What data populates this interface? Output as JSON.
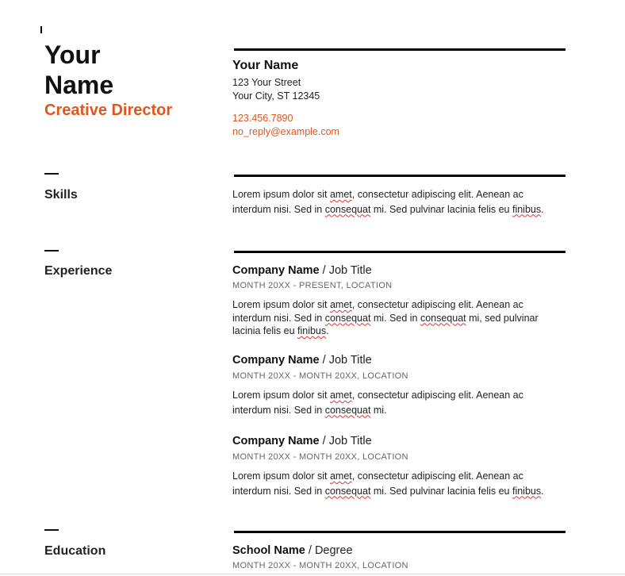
{
  "header": {
    "name_line1": "Your",
    "name_line2": "Name",
    "role": "Creative Director"
  },
  "contact": {
    "name": "Your Name",
    "street": "123 Your Street",
    "city": "Your City, ST 12345",
    "phone": "123.456.7890",
    "email": "no_reply@example.com"
  },
  "sections": {
    "skills": "Skills",
    "experience": "Experience",
    "education": "Education"
  },
  "skills": {
    "line1_a": "Lorem ipsum dolor sit ",
    "line1_b": "amet",
    "line1_c": ", consectetur adipiscing elit. Aenean ac",
    "line2_a": "interdum nisi. Sed in ",
    "line2_b": "consequat",
    "line2_c": " mi. Sed pulvinar lacinia felis eu ",
    "line2_d": "finibus",
    "line2_e": "."
  },
  "experience": [
    {
      "company": "Company Name",
      "sep": " / ",
      "title": "Job Title",
      "meta": "MONTH 20XX - PRESENT,  LOCATION",
      "l1a": "Lorem ipsum dolor sit ",
      "l1b": "amet",
      "l1c": ", consectetur adipiscing elit. Aenean ac",
      "l2a": "interdum nisi. Sed in ",
      "l2b": "consequat",
      "l2c": " mi. Sed in ",
      "l2d": "consequat",
      "l2e": " mi, sed pulvinar",
      "l3a": "lacinia felis eu ",
      "l3b": "finibus",
      "l3c": "."
    },
    {
      "company": "Company Name",
      "sep": " / ",
      "title": "Job Title",
      "meta": "MONTH 20XX - MONTH 20XX,  LOCATION",
      "l1a": "Lorem ipsum dolor sit ",
      "l1b": "amet",
      "l1c": ", consectetur adipiscing elit. Aenean ac",
      "l2a": "interdum nisi. Sed in ",
      "l2b": "consequat",
      "l2c": " mi."
    },
    {
      "company": "Company Name",
      "sep": " / ",
      "title": "Job Title",
      "meta": "MONTH 20XX - MONTH 20XX,  LOCATION",
      "l1a": "Lorem ipsum dolor sit ",
      "l1b": "amet",
      "l1c": ", consectetur adipiscing elit. Aenean ac",
      "l2a": "interdum nisi. Sed in ",
      "l2b": "consequat",
      "l2c": " mi. Sed pulvinar lacinia felis eu ",
      "l2d": "finibus",
      "l2e": "."
    }
  ],
  "education": {
    "school": "School Name",
    "sep": " / ",
    "degree": "Degree",
    "meta": "MONTH 20XX - MONTH 20XX,  LOCATION"
  },
  "colors": {
    "accent": "#e0561f",
    "text": "#111111",
    "muted": "#666666",
    "spellcheck": "#dd3333"
  }
}
